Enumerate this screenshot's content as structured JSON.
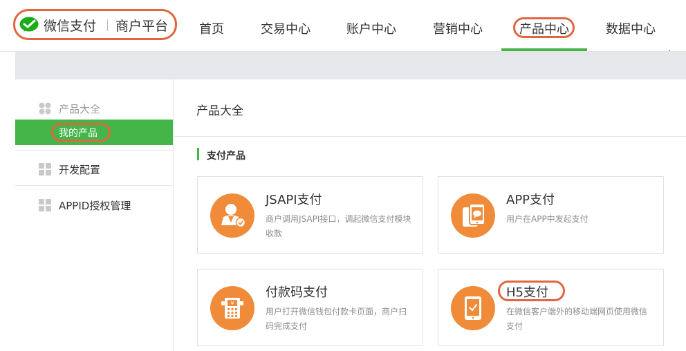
{
  "header": {
    "brand": "微信支付",
    "sub_brand": "商户平台",
    "nav": [
      "首页",
      "交易中心",
      "账户中心",
      "营销中心",
      "产品中心",
      "数据中心"
    ],
    "active_nav": "产品中心"
  },
  "sidebar": {
    "groups": [
      {
        "label": "产品大全",
        "icon": "clover-icon",
        "children": [
          "我的产品"
        ]
      },
      {
        "label": "开发配置",
        "icon": "grid-icon"
      },
      {
        "label": "APPID授权管理",
        "icon": "grid-icon"
      }
    ],
    "active_item": "我的产品"
  },
  "main": {
    "title": "产品大全",
    "section_title": "支付产品",
    "cards": [
      {
        "title": "JSAPI支付",
        "desc": "商户调用JSAPI接口，调起微信支付模块收款",
        "icon": "user-check-icon"
      },
      {
        "title": "APP支付",
        "desc": "用户在APP中发起支付",
        "icon": "phone-chat-icon"
      },
      {
        "title": "付款码支付",
        "desc": "用户打开微信钱包付款卡页面，商户扫码完成支付",
        "icon": "pos-terminal-icon"
      },
      {
        "title": "H5支付",
        "desc": "在微信客户端外的移动端网页使用微信支付",
        "icon": "tablet-check-icon"
      }
    ]
  },
  "colors": {
    "accent_green": "#44b549",
    "icon_orange": "#f08b3a",
    "highlight_red": "#e0663e"
  }
}
